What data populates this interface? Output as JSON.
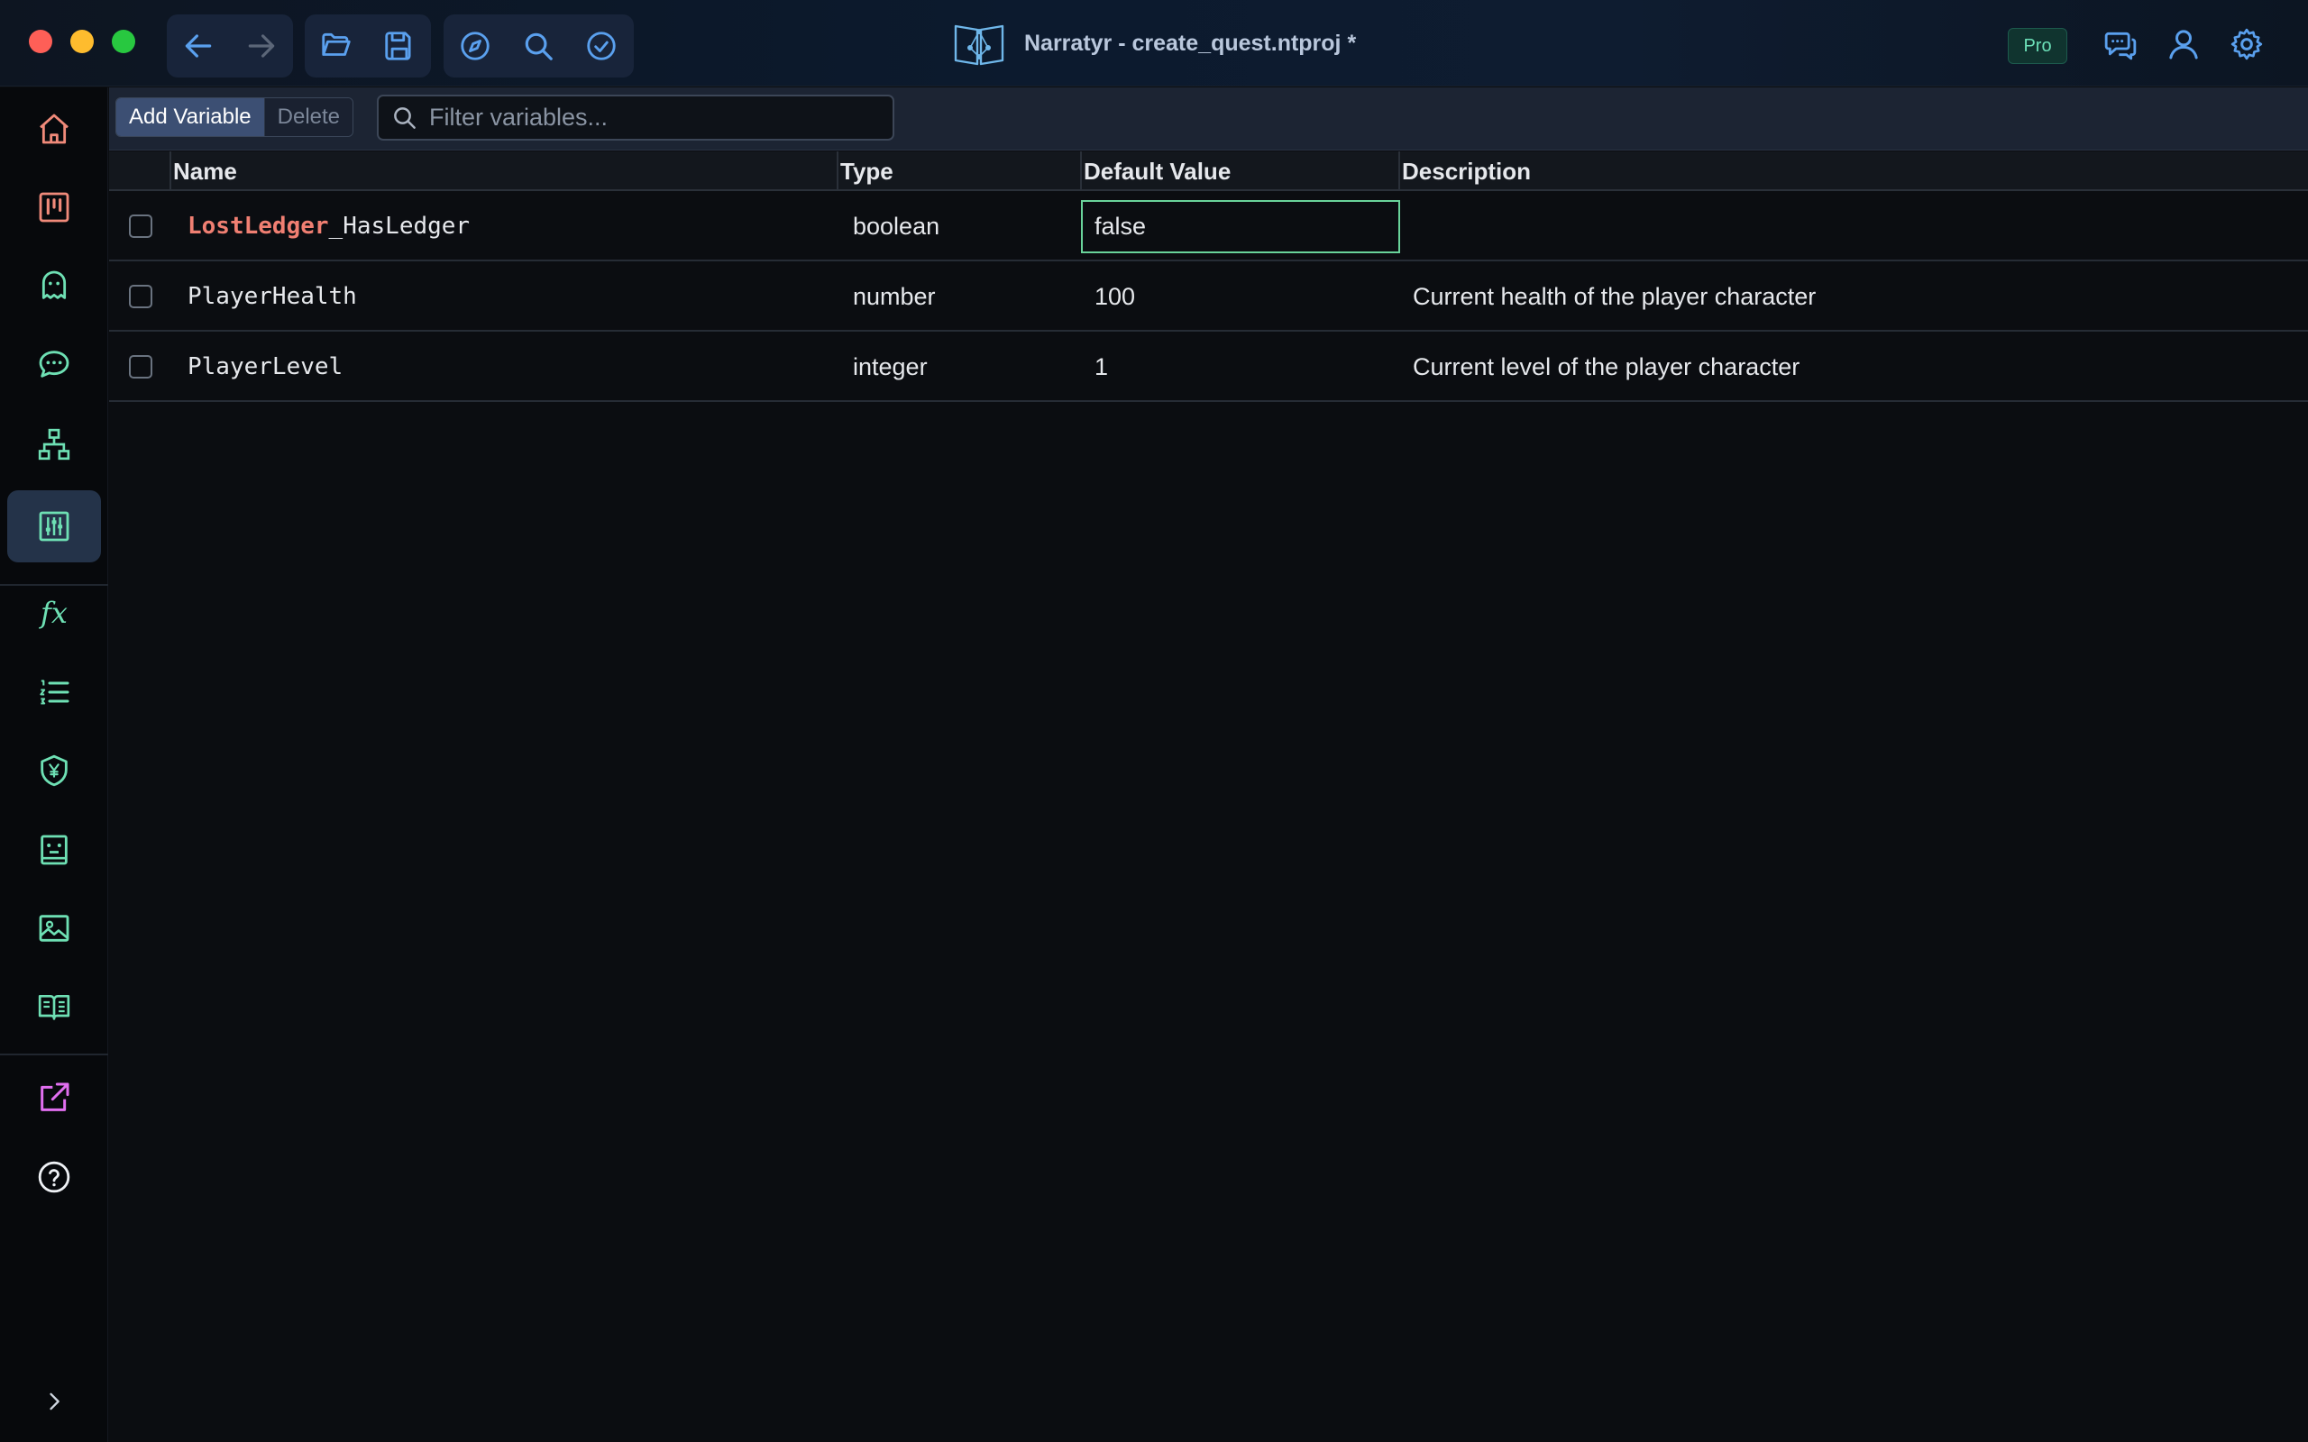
{
  "window": {
    "title": "Narratyr - create_quest.ntproj *",
    "badge": "Pro"
  },
  "titlebar_icons": {
    "nav": [
      "back-arrow-icon",
      "forward-arrow-icon"
    ],
    "file": [
      "folder-open-icon",
      "save-icon"
    ],
    "tools": [
      "compass-icon",
      "search-icon",
      "check-circle-icon"
    ],
    "right": [
      "chat-bubbles-icon",
      "user-icon",
      "gear-icon"
    ]
  },
  "sidebar": {
    "items": [
      {
        "icon": "home-icon"
      },
      {
        "icon": "kanban-board-icon"
      },
      {
        "icon": "ghost-icon"
      },
      {
        "icon": "dialogue-icon"
      },
      {
        "icon": "hierarchy-icon"
      },
      {
        "icon": "variables-icon",
        "active": true
      },
      {
        "icon": "function-icon",
        "label": "fx"
      },
      {
        "icon": "numbered-list-icon"
      },
      {
        "icon": "currency-shield-icon"
      },
      {
        "icon": "character-card-icon"
      },
      {
        "icon": "image-icon"
      },
      {
        "icon": "book-icon"
      },
      {
        "icon": "export-icon"
      },
      {
        "icon": "help-icon"
      },
      {
        "icon": "expand-chevron-icon"
      }
    ]
  },
  "toolbar": {
    "add_label": "Add Variable",
    "delete_label": "Delete",
    "filter_placeholder": "Filter variables...",
    "filter_value": ""
  },
  "table": {
    "columns": [
      "Name",
      "Type",
      "Default Value",
      "Description"
    ],
    "rows": [
      {
        "name_prefix": "LostLedger",
        "name_rest": "_HasLedger",
        "type": "boolean",
        "default": "false",
        "description": "",
        "editing": true
      },
      {
        "name_prefix": "",
        "name_rest": "PlayerHealth",
        "type": "number",
        "default": "100",
        "description": "Current health of the player character"
      },
      {
        "name_prefix": "",
        "name_rest": "PlayerLevel",
        "type": "integer",
        "default": "1",
        "description": "Current level of the player character"
      }
    ]
  },
  "colors": {
    "accent_blue": "#4a90e2",
    "accent_green": "#6ee0b4",
    "name_prefix": "#f07f72",
    "edit_border": "#69d39a"
  }
}
